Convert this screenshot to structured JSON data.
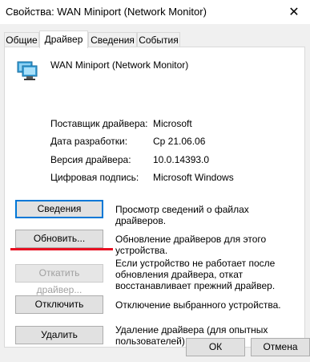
{
  "window": {
    "title": "Свойства: WAN Miniport (Network Monitor)",
    "close_glyph": "✕"
  },
  "tabs": [
    {
      "label": "Общие"
    },
    {
      "label": "Драйвер"
    },
    {
      "label": "Сведения"
    },
    {
      "label": "События"
    }
  ],
  "device": {
    "name": "WAN Miniport (Network Monitor)",
    "icon": "network-adapter-icon"
  },
  "properties": [
    {
      "label": "Поставщик драйвера:",
      "value": "Microsoft"
    },
    {
      "label": "Дата разработки:",
      "value": "Ср 21.06.06"
    },
    {
      "label": "Версия драйвера:",
      "value": "10.0.14393.0"
    },
    {
      "label": "Цифровая подпись:",
      "value": "Microsoft Windows"
    }
  ],
  "actions": [
    {
      "label": "Сведения",
      "description": "Просмотр сведений о файлах драйверов."
    },
    {
      "label": "Обновить...",
      "description": "Обновление драйверов для этого устройства."
    },
    {
      "label": "Откатить драйвер...",
      "description": "Если устройство не работает после обновления драйвера, откат восстанавливает прежний драйвер."
    },
    {
      "label": "Отключить",
      "description": "Отключение выбранного устройства."
    },
    {
      "label": "Удалить",
      "description": "Удаление драйвера (для опытных пользователей)."
    }
  ],
  "footer": {
    "ok_label": "ОК",
    "cancel_label": "Отмена"
  },
  "colors": {
    "accent": "#0078d7",
    "highlight_line": "#e81123"
  }
}
